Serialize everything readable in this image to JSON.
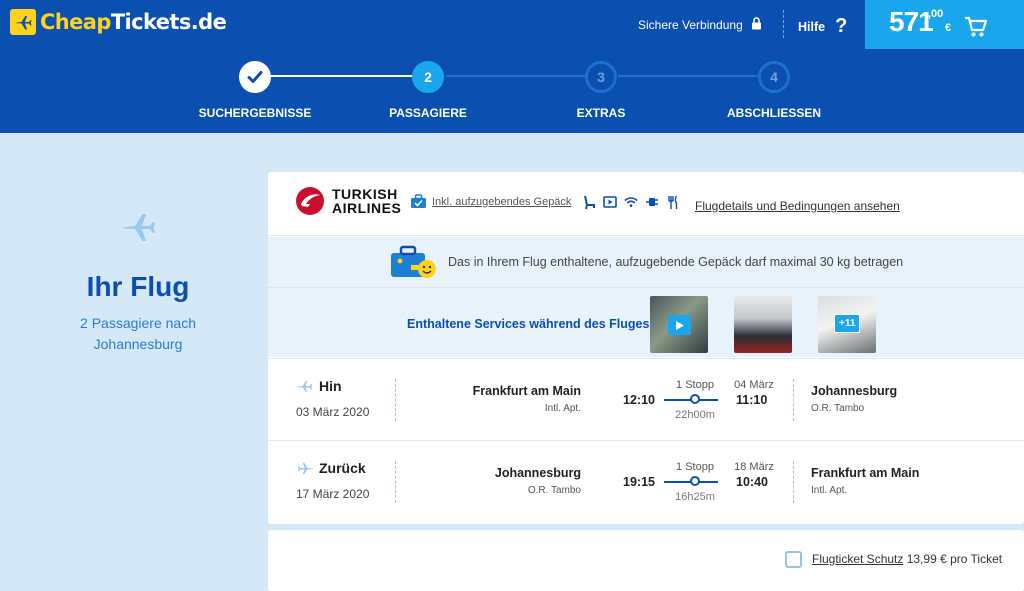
{
  "header": {
    "logo": {
      "prefix": "Cheap",
      "suffix": "Tickets.de"
    },
    "secure_label": "Sichere Verbindung",
    "help_label": "Hilfe",
    "help_symbol": "?",
    "cart": {
      "price_int": "571",
      "price_dec": ",00",
      "currency": "€"
    }
  },
  "steps": [
    {
      "number": "✔",
      "label": "SUCHERGEBNISSE",
      "state": "done"
    },
    {
      "number": "2",
      "label": "PASSAGIERE",
      "state": "active"
    },
    {
      "number": "3",
      "label": "EXTRAS",
      "state": "pending"
    },
    {
      "number": "4",
      "label": "ABSCHLIESSEN",
      "state": "pending"
    }
  ],
  "summary": {
    "title": "Ihr Flug",
    "subtitle_line1": "2 Passagiere nach",
    "subtitle_line2": "Johannesburg"
  },
  "airline": {
    "name_line1": "TURKISH",
    "name_line2": "AIRLINES",
    "baggage_label": "Inkl. aufzugebendes Gepäck",
    "details_link": "Flugdetails und Bedingungen ansehen"
  },
  "baggage_info": "Das in Ihrem Flug enthaltene, aufzugebende Gepäck darf maximal 30 kg betragen",
  "services": {
    "label": "Enthaltene Services während des Fluges:",
    "more_badge": "+11"
  },
  "flights": {
    "outbound": {
      "direction": "Hin",
      "date": "03 März 2020",
      "from_city": "Frankfurt am Main",
      "from_airport": "Intl. Apt.",
      "dep_time": "12:10",
      "stops": "1 Stopp",
      "duration": "22h00m",
      "arr_date": "04 März",
      "arr_time": "11:10",
      "to_city": "Johannesburg",
      "to_airport": "O.R. Tambo"
    },
    "return": {
      "direction": "Zurück",
      "date": "17 März 2020",
      "from_city": "Johannesburg",
      "from_airport": "O.R. Tambo",
      "dep_time": "19:15",
      "stops": "1 Stopp",
      "duration": "16h25m",
      "arr_date": "18 März",
      "arr_time": "10:40",
      "to_city": "Frankfurt am Main",
      "to_airport": "Intl. Apt."
    }
  },
  "insurance": {
    "link_label": "Flugticket Schutz",
    "price_text": " 13,99 € pro Ticket"
  },
  "colors": {
    "brand_blue": "#0b4fb0",
    "accent_cyan": "#1aa6ec",
    "logo_yellow": "#ffd21e",
    "airline_red": "#c8102e"
  }
}
